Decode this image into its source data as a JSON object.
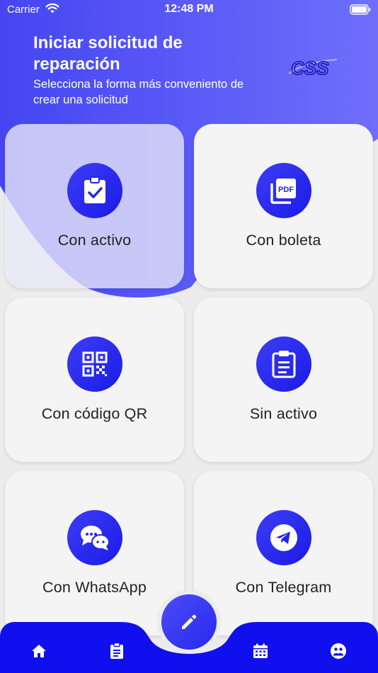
{
  "status_bar": {
    "carrier": "Carrier",
    "time": "12:48 PM"
  },
  "header": {
    "title": "Iniciar solicitud de reparación",
    "subtitle": "Selecciona la forma más conveniento de crear una solicitud",
    "logo_text": "CSS"
  },
  "options": [
    {
      "label": "Con activo",
      "icon": "clipboard-check-icon"
    },
    {
      "label": "Con boleta",
      "icon": "pdf-file-icon"
    },
    {
      "label": "Con código QR",
      "icon": "qr-code-icon"
    },
    {
      "label": "Sin activo",
      "icon": "clipboard-list-icon"
    },
    {
      "label": "Con WhatsApp",
      "icon": "chat-bubbles-icon"
    },
    {
      "label": "Con Telegram",
      "icon": "telegram-icon"
    }
  ],
  "bottom_nav": {
    "items": [
      "home-icon",
      "clipboard-icon",
      "calendar-icon",
      "profile-icon"
    ],
    "fab_icon": "pencil-icon"
  },
  "colors": {
    "primary": "#2b2bf0",
    "header_gradient_start": "#4a4af4",
    "header_gradient_end": "#6d6dfb",
    "card_bg": "#f4f4f4"
  }
}
